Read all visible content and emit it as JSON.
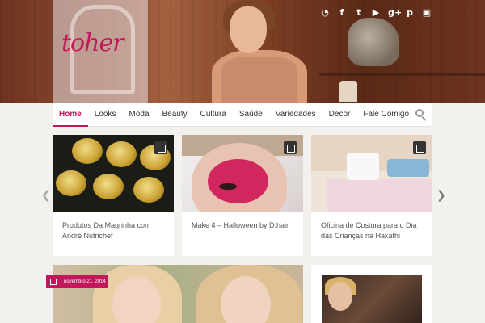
{
  "brand": {
    "logo_text": "toher"
  },
  "social_icons": [
    "rss-icon",
    "facebook-icon",
    "twitter-icon",
    "youtube-icon",
    "google-plus-icon",
    "pinterest-icon",
    "instagram-icon"
  ],
  "social_glyphs": [
    "◔",
    "f",
    "t",
    "▶",
    "g+",
    "p",
    "▣"
  ],
  "nav": {
    "items": [
      "Home",
      "Looks",
      "Moda",
      "Beauty",
      "Cultura",
      "Saúde",
      "Variedades",
      "Decor",
      "Fale Comigo"
    ],
    "active_index": 0
  },
  "carousel": {
    "prev_glyph": "❮",
    "next_glyph": "❯",
    "cards": [
      {
        "title": "Produtos Da Magrinha com André Nutrichef"
      },
      {
        "title": "Make 4 – Halloween by D.hair"
      },
      {
        "title": "Oficina de Costura para o Dia das Crianças na Hakathi"
      }
    ]
  },
  "featured": {
    "date": "novembro 21, 2014"
  },
  "colors": {
    "accent": "#c2185b",
    "nav_bg": "#ffffff",
    "page_bg": "#f3f1ee"
  }
}
